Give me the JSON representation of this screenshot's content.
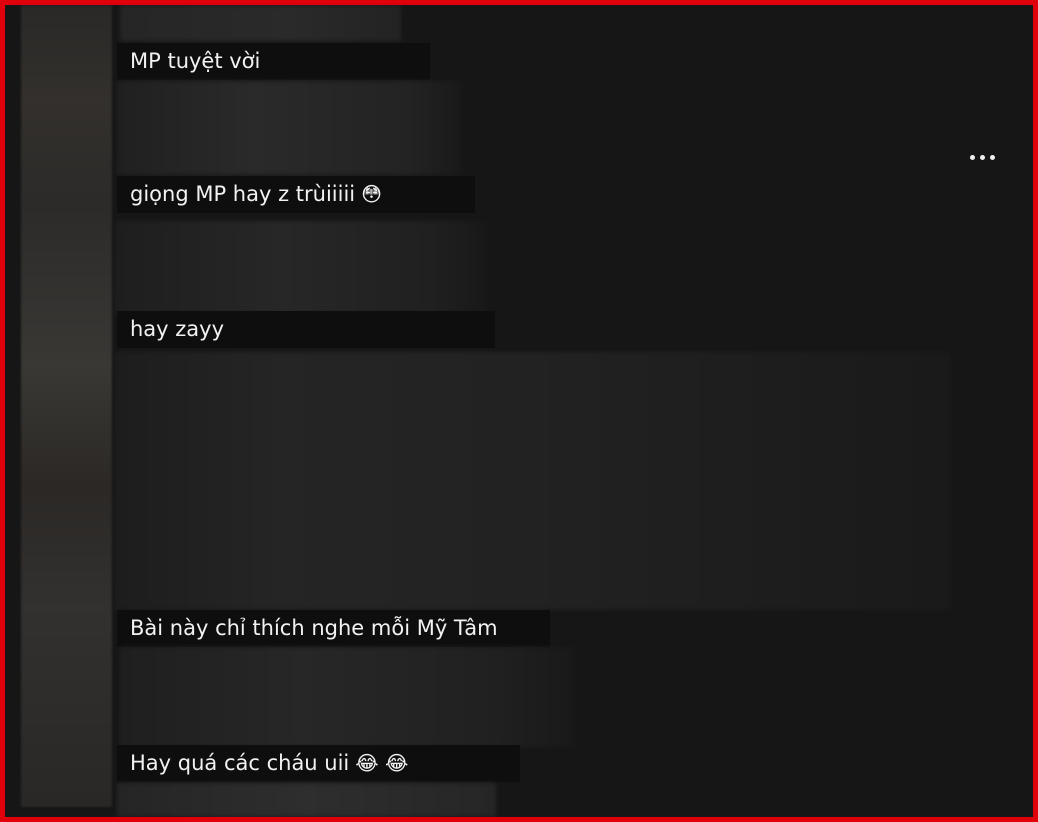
{
  "comments": [
    {
      "text": "MP tuyệt vời",
      "emoji": ""
    },
    {
      "text": "giọng MP hay z trùiiiii",
      "emoji": "😳"
    },
    {
      "text": "hay zayy",
      "emoji": ""
    },
    {
      "text": "Bài này chỉ thích nghe mỗi Mỹ Tâm",
      "emoji": ""
    },
    {
      "text": "Hay quá các cháu uii",
      "emoji": "😂 😂"
    }
  ],
  "more_menu": {
    "icon": "more-horizontal-icon"
  },
  "colors": {
    "frame": "#e0000b",
    "background": "#121212",
    "caption_bg": "#0e0e0e",
    "text": "#f2f2f2"
  }
}
